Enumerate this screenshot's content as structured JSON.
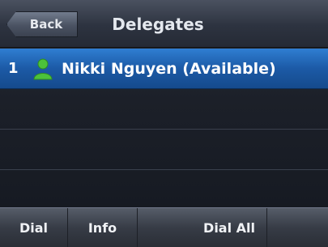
{
  "header": {
    "back_label": "Back",
    "title": "Delegates"
  },
  "delegates": [
    {
      "index": "1",
      "name": "Nikki Nguyen (Available)",
      "status": "available",
      "status_color": "#4cc23a"
    }
  ],
  "softkeys": {
    "dial": "Dial",
    "info": "Info",
    "dial_all": "Dial All",
    "empty": ""
  },
  "colors": {
    "selected_row": "#1c5aa6",
    "header": "#2d3340",
    "background": "#1c2029"
  }
}
